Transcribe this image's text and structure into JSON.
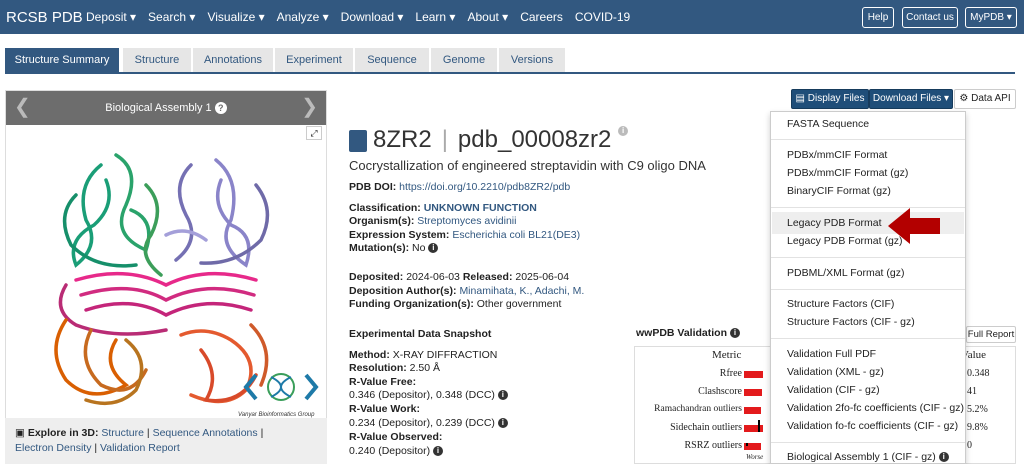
{
  "topnav": {
    "brand": "RCSB PDB",
    "items": [
      "Deposit ▾",
      "Search ▾",
      "Visualize ▾",
      "Analyze ▾",
      "Download ▾",
      "Learn ▾",
      "About ▾",
      "Careers",
      "COVID-19"
    ],
    "help": "Help",
    "contact": "Contact us",
    "mypdb": "MyPDB ▾"
  },
  "tabs": [
    "Structure Summary",
    "Structure",
    "Annotations",
    "Experiment",
    "Sequence",
    "Genome",
    "Versions"
  ],
  "assembly": {
    "title": "Biological Assembly 1",
    "watermark": "Vanyar Bioinformatics Group"
  },
  "explore": {
    "prefix": "Explore in 3D:",
    "links": [
      "Structure",
      "Sequence Annotations",
      "Electron Density",
      "Validation Report"
    ],
    "sep": "|"
  },
  "entry": {
    "id": "8ZR2",
    "ext_id": "pdb_00008zr2",
    "title": "Cocrystallization of engineered streptavidin with C9 oligo DNA",
    "doi_label": "PDB DOI:",
    "doi": "https://doi.org/10.2210/pdb8ZR2/pdb",
    "class_label": "Classification:",
    "classification": "UNKNOWN FUNCTION",
    "org_label": "Organism(s):",
    "organism": "Streptomyces avidinii",
    "expr_label": "Expression System:",
    "expression": "Escherichia coli BL21(DE3)",
    "mut_label": "Mutation(s):",
    "mutation": "No",
    "dep_label": "Deposited:",
    "deposited": "2024-06-03",
    "rel_label": "Released:",
    "released": "2025-06-04",
    "auth_label": "Deposition Author(s):",
    "authors": "Minamihata, K., Adachi, M.",
    "fund_label": "Funding Organization(s):",
    "funding": "Other government"
  },
  "snapshot": {
    "heading": "Experimental Data Snapshot",
    "method_label": "Method:",
    "method": "X-RAY DIFFRACTION",
    "res_label": "Resolution:",
    "resolution": "2.50 Å",
    "rfree_label": "R-Value Free:",
    "rfree": "0.346 (Depositor), 0.348 (DCC)",
    "rwork_label": "R-Value Work:",
    "rwork": "0.234 (Depositor), 0.239 (DCC)",
    "robs_label": "R-Value Observed:",
    "robs": "0.240 (Depositor)"
  },
  "validation": {
    "heading": "wwPDB Validation",
    "full_report": "Full Report",
    "metric_header": "Metric",
    "value_header": "Value",
    "worse": "Worse",
    "metrics": [
      "Rfree",
      "Clashscore",
      "Ramachandran outliers",
      "Sidechain outliers",
      "RSRZ outliers"
    ],
    "values": [
      "0.348",
      "41",
      "5.2%",
      "9.8%",
      "0"
    ],
    "bar_fill": [
      0.8,
      0.75,
      0.7,
      0.8,
      0.72
    ]
  },
  "buttons": {
    "display": "Display Files ▾",
    "download": "Download Files ▾",
    "api": "Data API"
  },
  "download_menu": [
    "FASTA Sequence",
    "PDBx/mmCIF Format",
    "PDBx/mmCIF Format (gz)",
    "BinaryCIF Format (gz)",
    "Legacy PDB Format",
    "Legacy PDB Format (gz)",
    "PDBML/XML Format (gz)",
    "Structure Factors (CIF)",
    "Structure Factors (CIF - gz)",
    "Validation Full PDF",
    "Validation (XML - gz)",
    "Validation (CIF - gz)",
    "Validation 2fo-fc coefficients (CIF - gz)",
    "Validation fo-fc coefficients (CIF - gz)",
    "Biological Assembly 1 (CIF - gz)"
  ],
  "colors": {
    "brand": "#325880",
    "arrow": "#b30000",
    "bar": "#e31a1c"
  }
}
